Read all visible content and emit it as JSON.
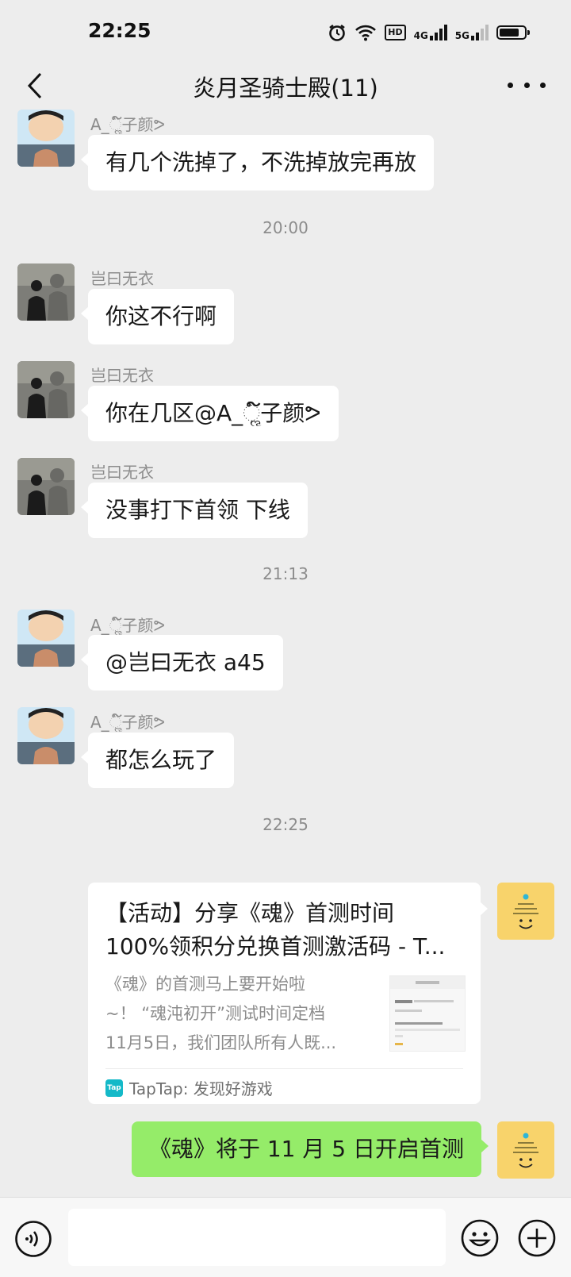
{
  "status_bar": {
    "time": "22:25",
    "net_hd": "HD",
    "net_4g": "4G",
    "net_5g": "5G",
    "battery_level": 0.8
  },
  "header": {
    "title": "炎月圣骑士殿(11)"
  },
  "messages": [
    {
      "sender": "A_ૢ໌子颜ᕗ",
      "text": "有几个洗掉了，不洗掉放完再放"
    },
    {
      "time": "20:00"
    },
    {
      "sender": "岂曰无衣",
      "text": "你这不行啊"
    },
    {
      "sender": "岂曰无衣",
      "text": "你在几区@A_ૢ໌子颜ᕗ"
    },
    {
      "sender": "岂曰无衣",
      "text": "没事打下首领  下线"
    },
    {
      "time": "21:13"
    },
    {
      "sender": "A_ૢ໌子颜ᕗ",
      "text": "@岂曰无衣  a45"
    },
    {
      "sender": "A_ૢ໌子颜ᕗ",
      "text": "都怎么玩了"
    },
    {
      "time": "22:25"
    }
  ],
  "link_card": {
    "title_line1": "【活动】分享《魂》首测时间",
    "title_line2": "100%领积分兑换首测激活码 - T...",
    "desc_line1": "《魂》的首测马上要开始啦",
    "desc_line2": "~！ “魂沌初开”测试时间定档",
    "desc_line3": "11月5日，我们团队所有人既...",
    "source_icon_text": "Tap",
    "source": "TapTap: 发现好游戏"
  },
  "my_message": {
    "text": "《魂》将于 11 月 5 日开启首测"
  },
  "colors": {
    "background": "#ededed",
    "my_bubble": "#95ec69",
    "other_bubble": "#ffffff",
    "taptap": "#14b9c8"
  },
  "icons": {
    "back": "chevron-left-icon",
    "more": "more-dots-icon",
    "voice": "voice-icon",
    "emoji": "emoji-icon",
    "plus": "plus-icon"
  }
}
